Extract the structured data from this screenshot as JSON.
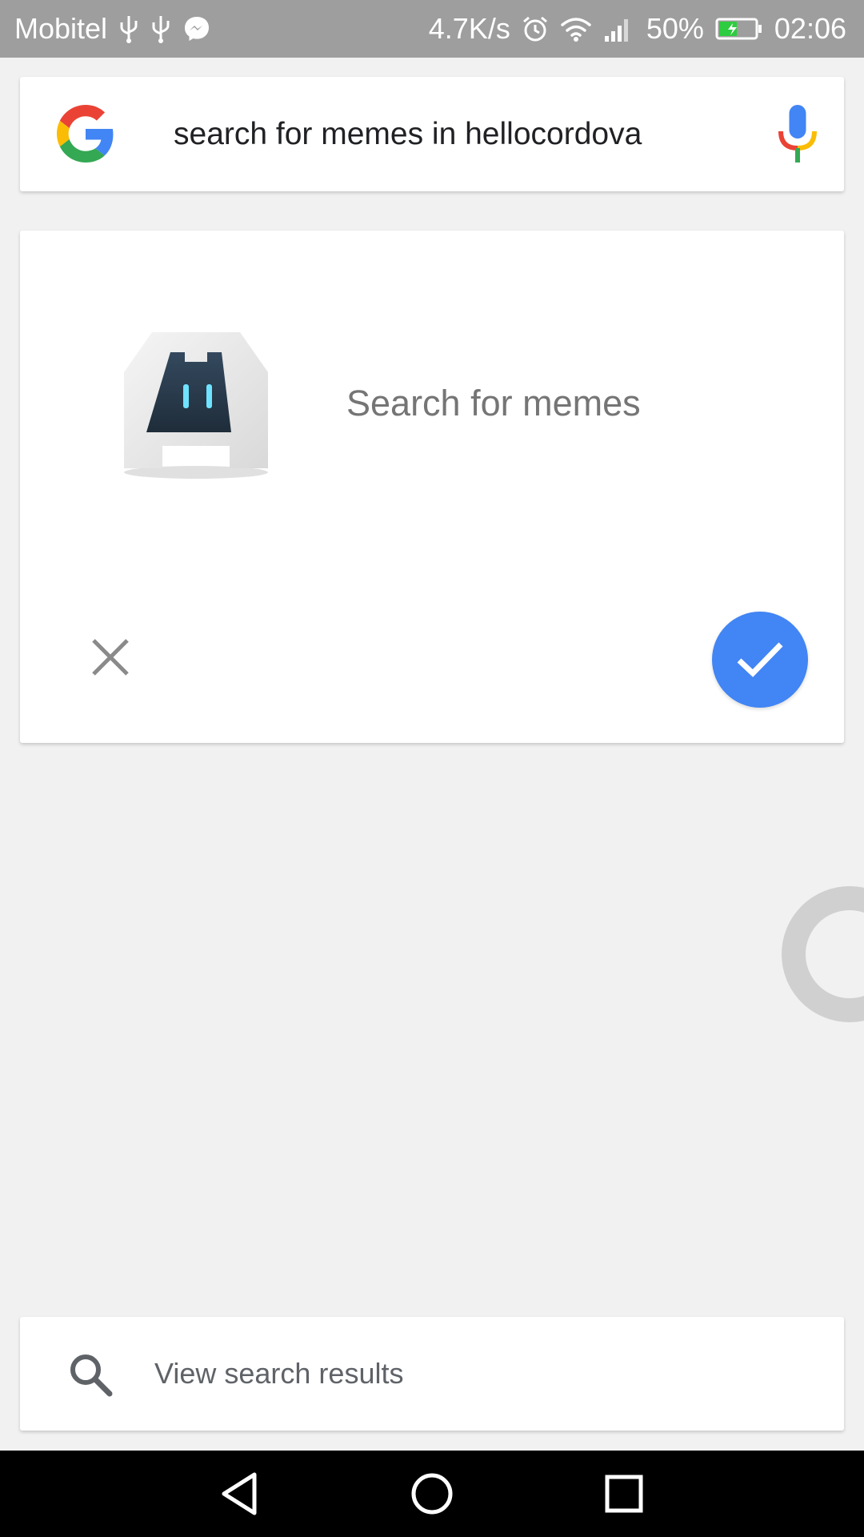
{
  "status_bar": {
    "carrier": "Mobitel",
    "net_speed": "4.7K/s",
    "battery_percent": "50%",
    "time": "02:06",
    "left_icons": [
      "usb-icon",
      "usb-icon",
      "messenger-icon"
    ],
    "right_icons": [
      "alarm-icon",
      "wifi-icon",
      "signal-icon",
      "battery-charging-icon"
    ]
  },
  "search_bar": {
    "query": "search for memes in hellocordova",
    "logo_icon": "google-g-logo",
    "mic_icon": "mic-icon"
  },
  "action_card": {
    "app_icon": "cordova-app-icon",
    "label": "Search for memes",
    "cancel_icon": "close-icon",
    "confirm_icon": "check-icon",
    "confirm_color": "#4285f4"
  },
  "results_card": {
    "label": "View search results",
    "icon": "search-icon"
  },
  "nav_bar": {
    "buttons": [
      "back-icon",
      "home-icon",
      "recents-icon"
    ]
  },
  "colors": {
    "status_bar_bg": "#9e9e9e",
    "page_bg": "#f1f1f1",
    "accent_blue": "#4285f4"
  }
}
